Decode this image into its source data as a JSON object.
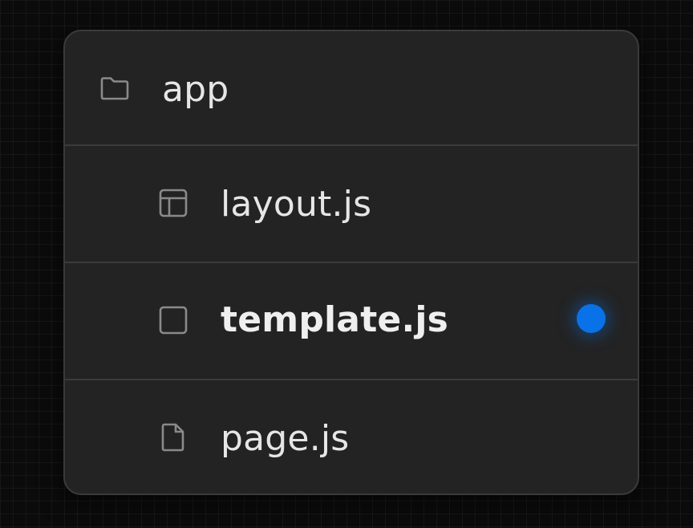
{
  "tree": {
    "items": [
      {
        "label": "app",
        "icon": "folder-icon",
        "bold": false,
        "level": 0
      },
      {
        "label": "layout.js",
        "icon": "layout-icon",
        "bold": false,
        "level": 1
      },
      {
        "label": "template.js",
        "icon": "square-icon",
        "bold": true,
        "level": 1,
        "status": "active"
      },
      {
        "label": "page.js",
        "icon": "file-icon",
        "bold": false,
        "level": 1
      }
    ]
  },
  "colors": {
    "background": "#0b0b0b",
    "card": "#232323",
    "text": "#e6e6e6",
    "icon": "#8a8a8a",
    "accent": "#0a72e8"
  }
}
